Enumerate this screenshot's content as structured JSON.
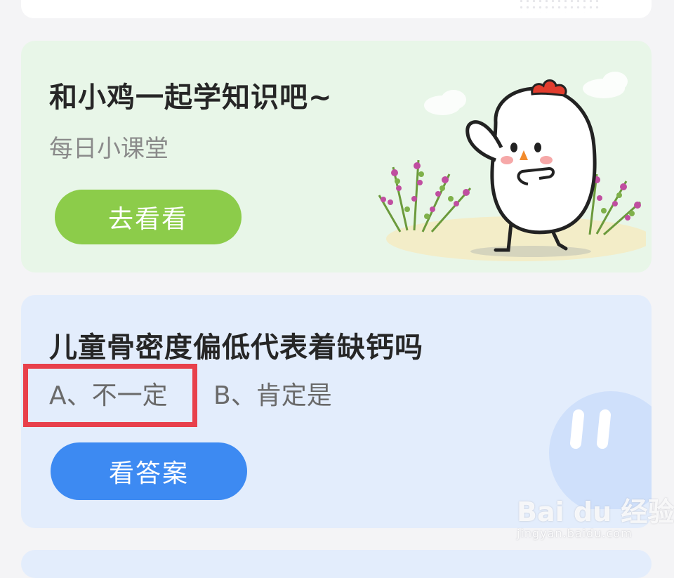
{
  "promo": {
    "title": "和小鸡一起学知识吧~",
    "subtitle": "每日小课堂",
    "button_label": "去看看"
  },
  "quiz": {
    "question": "儿童骨密度偏低代表着缺钙吗",
    "option_a": "A、不一定",
    "option_b": "B、肯定是",
    "button_label": "看答案"
  },
  "watermark": {
    "logo_text": "Bai du 经验",
    "url": "jingyan.baidu.com"
  },
  "colors": {
    "promo_bg": "#e8f6e8",
    "promo_button": "#8ccc4a",
    "quiz_bg": "#e3edfc",
    "quiz_button": "#3d8af2",
    "highlight": "#e8404b"
  },
  "icons": {
    "chick": "chick-mascot-illustration",
    "blob": "blue-blob-mascot"
  }
}
